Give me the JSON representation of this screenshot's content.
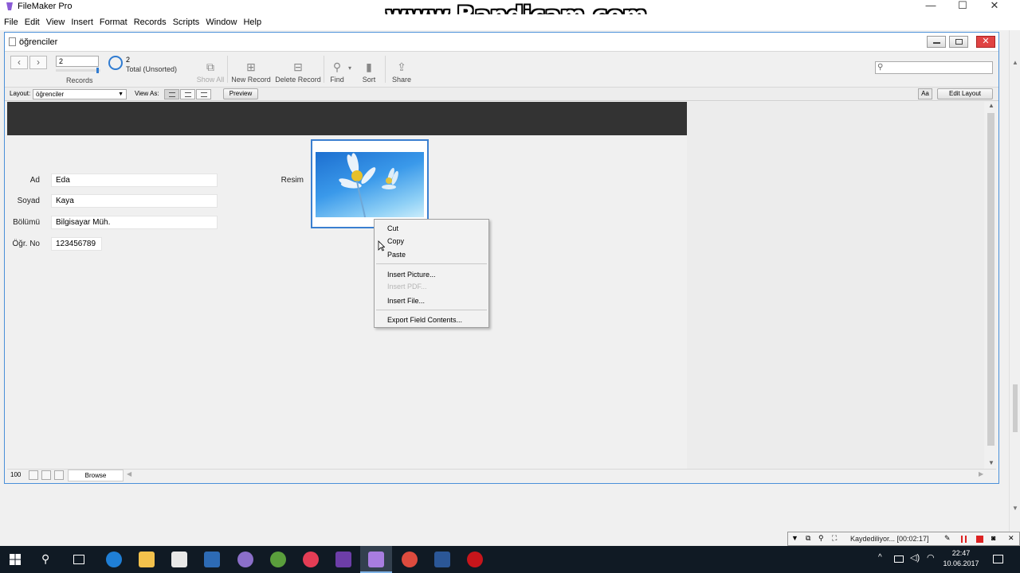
{
  "app": {
    "title": "FileMaker Pro",
    "watermark": "www.Bandicam.com"
  },
  "menu": [
    "File",
    "Edit",
    "View",
    "Insert",
    "Format",
    "Records",
    "Scripts",
    "Window",
    "Help"
  ],
  "document": {
    "title": "öğrenciler"
  },
  "toolbar": {
    "record_number": "2",
    "records_label": "Records",
    "found_count": "2",
    "found_status": "Total (Unsorted)",
    "show_all": "Show All",
    "new_record": "New Record",
    "delete_record": "Delete Record",
    "find": "Find",
    "sort": "Sort",
    "share": "Share"
  },
  "layoutbar": {
    "layout_label": "Layout:",
    "layout_value": "öğrenciler",
    "view_as_label": "View As:",
    "preview": "Preview",
    "font_icon": "Aa",
    "edit_layout": "Edit Layout"
  },
  "form": {
    "fields": [
      {
        "label": "Ad",
        "value": "Eda"
      },
      {
        "label": "Soyad",
        "value": "Kaya"
      },
      {
        "label": "Bölümü",
        "value": "Bilgisayar Müh."
      },
      {
        "label": "Öğr. No",
        "value": "123456789"
      }
    ],
    "resim_label": "Resim"
  },
  "context_menu": {
    "items": [
      {
        "label": "Cut",
        "enabled": true
      },
      {
        "label": "Copy",
        "enabled": true
      },
      {
        "label": "Paste",
        "enabled": true
      },
      {
        "label": "Insert Picture...",
        "enabled": true
      },
      {
        "label": "Insert PDF...",
        "enabled": false
      },
      {
        "label": "Insert File...",
        "enabled": true
      },
      {
        "label": "Export Field Contents...",
        "enabled": true
      }
    ]
  },
  "statusbar": {
    "zoom": "100",
    "mode": "Browse"
  },
  "recording": {
    "status": "Kaydediliyor... [00:02:17]"
  },
  "tray": {
    "time": "22:47",
    "date": "10.06.2017"
  },
  "colors": {
    "header_band": "#333333",
    "accent": "#2f7bd1",
    "close_red": "#e04343",
    "taskbar": "#101a24"
  }
}
